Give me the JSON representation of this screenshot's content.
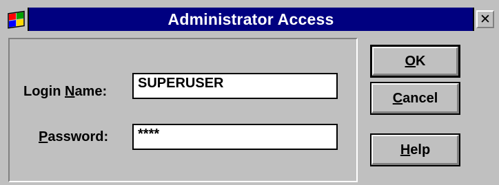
{
  "window": {
    "title": "Administrator Access",
    "close_glyph": "✕",
    "system_menu_icon": "windows-flag-icon"
  },
  "form": {
    "login_label_pre": "Login ",
    "login_label_accel": "N",
    "login_label_post": "ame:",
    "login_value": "SUPERUSER",
    "password_label_accel": "P",
    "password_label_post": "assword:",
    "password_value": "****"
  },
  "buttons": {
    "ok_accel": "O",
    "ok_post": "K",
    "cancel_accel": "C",
    "cancel_post": "ancel",
    "help_accel": "H",
    "help_post": "elp"
  },
  "colors": {
    "title_bar": "#000080",
    "face": "#c0c0c0"
  }
}
